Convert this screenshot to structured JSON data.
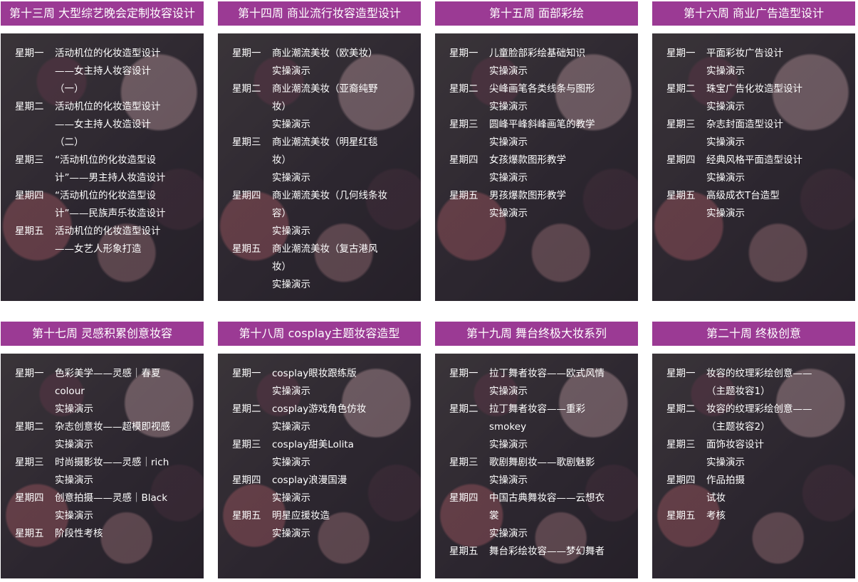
{
  "weeks": [
    {
      "title": "第十三周 大型综艺晚会定制妆容设计",
      "entries": [
        {
          "day": "星期一",
          "lines": [
            "活动机位的化妆造型设计",
            "——女主持人妆容设计",
            "（一）"
          ]
        },
        {
          "day": "星期二",
          "lines": [
            "活动机位的化妆造型设计",
            "——女主持人妆造设计",
            "（二）"
          ]
        },
        {
          "day": "星期三",
          "lines": [
            "“活动机位的化妆造型设",
            "计”——男主持人妆造设计"
          ]
        },
        {
          "day": "星期四",
          "lines": [
            "“活动机位的化妆造型设",
            "计”——民族声乐妆造设计"
          ]
        },
        {
          "day": "星期五",
          "lines": [
            "活动机位的化妆造型设计",
            "——女艺人形象打造"
          ]
        }
      ]
    },
    {
      "title": "第十四周 商业流行妆容造型设计",
      "entries": [
        {
          "day": "星期一",
          "lines": [
            "商业潮流美妆（欧美妆）",
            "实操演示"
          ]
        },
        {
          "day": "星期二",
          "lines": [
            "商业潮流美妆（亚裔纯野",
            "妆）",
            "实操演示"
          ]
        },
        {
          "day": "星期三",
          "lines": [
            "商业潮流美妆（明星红毯",
            "妆）",
            "实操演示"
          ]
        },
        {
          "day": "星期四",
          "lines": [
            "商业潮流美妆（几何线条妆",
            "容）",
            "实操演示"
          ]
        },
        {
          "day": "星期五",
          "lines": [
            "商业潮流美妆（复古港风",
            "妆）",
            "实操演示"
          ]
        }
      ]
    },
    {
      "title": "第十五周 面部彩绘",
      "entries": [
        {
          "day": "星期一",
          "lines": [
            "儿童脸部彩绘基础知识",
            "实操演示"
          ]
        },
        {
          "day": "星期二",
          "lines": [
            "尖峰画笔各类线条与图形",
            "实操演示"
          ]
        },
        {
          "day": "星期三",
          "lines": [
            "圆峰平峰斜峰画笔的教学",
            "实操演示"
          ]
        },
        {
          "day": "星期四",
          "lines": [
            "女孩爆款图形教学",
            "实操演示"
          ]
        },
        {
          "day": "星期五",
          "lines": [
            "男孩爆款图形教学",
            "实操演示"
          ]
        }
      ]
    },
    {
      "title": "第十六周 商业广告造型设计",
      "entries": [
        {
          "day": "星期一",
          "lines": [
            "平面彩妆广告设计",
            "实操演示"
          ]
        },
        {
          "day": "星期二",
          "lines": [
            "珠宝广告化妆造型设计",
            "实操演示"
          ]
        },
        {
          "day": "星期三",
          "lines": [
            "杂志封面造型设计",
            "实操演示"
          ]
        },
        {
          "day": "星期四",
          "lines": [
            "经典风格平面造型设计",
            "实操演示"
          ]
        },
        {
          "day": "星期五",
          "lines": [
            "高级成衣T台造型",
            "实操演示"
          ]
        }
      ]
    },
    {
      "title": "第十七周 灵感积累创意妆容",
      "entries": [
        {
          "day": "星期一",
          "lines": [
            "色彩美学——灵感｜春夏",
            "colour",
            "实操演示"
          ]
        },
        {
          "day": "星期二",
          "lines": [
            "杂志创意妆——超模即视感",
            "实操演示"
          ]
        },
        {
          "day": "星期三",
          "lines": [
            "时尚摄影妆——灵感｜rich",
            "实操演示"
          ]
        },
        {
          "day": "星期四",
          "lines": [
            "创意拍摄——灵感｜Black",
            "实操演示"
          ]
        },
        {
          "day": "星期五",
          "lines": [
            "阶段性考核"
          ]
        }
      ]
    },
    {
      "title": "第十八周 cosplay主题妆容造型",
      "entries": [
        {
          "day": "星期一",
          "lines": [
            "cosplay眼妆跟练版",
            "实操演示"
          ]
        },
        {
          "day": "星期二",
          "lines": [
            "cosplay游戏角色仿妆",
            "实操演示"
          ]
        },
        {
          "day": "星期三",
          "lines": [
            "cosplay甜美Lolita",
            "实操演示"
          ]
        },
        {
          "day": "星期四",
          "lines": [
            "cosplay浪漫国漫",
            "实操演示"
          ]
        },
        {
          "day": "星期五",
          "lines": [
            "明星应援妆造",
            "实操演示"
          ]
        }
      ]
    },
    {
      "title": "第十九周 舞台终极大妆系列",
      "entries": [
        {
          "day": "星期一",
          "lines": [
            "拉丁舞者妆容——欧式风情",
            "实操演示"
          ]
        },
        {
          "day": "星期二",
          "lines": [
            "拉丁舞者妆容——重彩",
            "smokey",
            "实操演示"
          ]
        },
        {
          "day": "星期三",
          "lines": [
            "歌剧舞剧妆——歌剧魅影",
            "实操演示"
          ]
        },
        {
          "day": "星期四",
          "lines": [
            "中国古典舞妆容——云想衣",
            "裳",
            "实操演示"
          ]
        },
        {
          "day": "星期五",
          "lines": [
            "舞台彩绘妆容——梦幻舞者"
          ]
        }
      ]
    },
    {
      "title": "第二十周 终极创意",
      "entries": [
        {
          "day": "星期一",
          "lines": [
            "妆容的纹理彩绘创意——",
            "（主题妆容1）"
          ]
        },
        {
          "day": "星期二",
          "lines": [
            "妆容的纹理彩绘创意——",
            "（主题妆容2）"
          ]
        },
        {
          "day": "星期三",
          "lines": [
            "面饰妆容设计",
            "实操演示"
          ]
        },
        {
          "day": "星期四",
          "lines": [
            "作品拍摄",
            "试妆"
          ]
        },
        {
          "day": "星期五",
          "lines": [
            "考核"
          ]
        }
      ]
    }
  ]
}
